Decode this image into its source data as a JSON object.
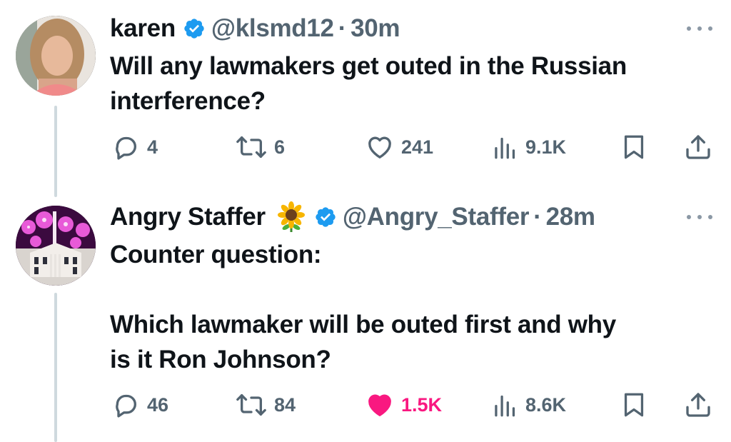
{
  "tweets": [
    {
      "display_name": "karen",
      "handle": "@klsmd12",
      "separator": "·",
      "time": "30m",
      "text": "Will any lawmakers get outed in the Russian\ninterference?",
      "actions": {
        "replies": "4",
        "retweets": "6",
        "likes": "241",
        "views": "9.1K"
      },
      "liked": false
    },
    {
      "display_name": "Angry Staffer",
      "emoji": "sunflower",
      "handle": "@Angry_Staffer",
      "separator": "·",
      "time": "28m",
      "text": "Counter question:\n\nWhich lawmaker will be outed first and why\nis it Ron Johnson?",
      "actions": {
        "replies": "46",
        "retweets": "84",
        "likes": "1.5K",
        "views": "8.6K"
      },
      "liked": true
    }
  ],
  "colors": {
    "text": "#0f1419",
    "secondary": "#536471",
    "verified": "#1d9bf0",
    "like": "#f91880",
    "thread_line": "#cfd9de"
  },
  "icons": [
    "reply-icon",
    "retweet-icon",
    "like-icon",
    "views-icon",
    "bookmark-icon",
    "share-icon",
    "verified-badge-icon",
    "more-icon"
  ]
}
